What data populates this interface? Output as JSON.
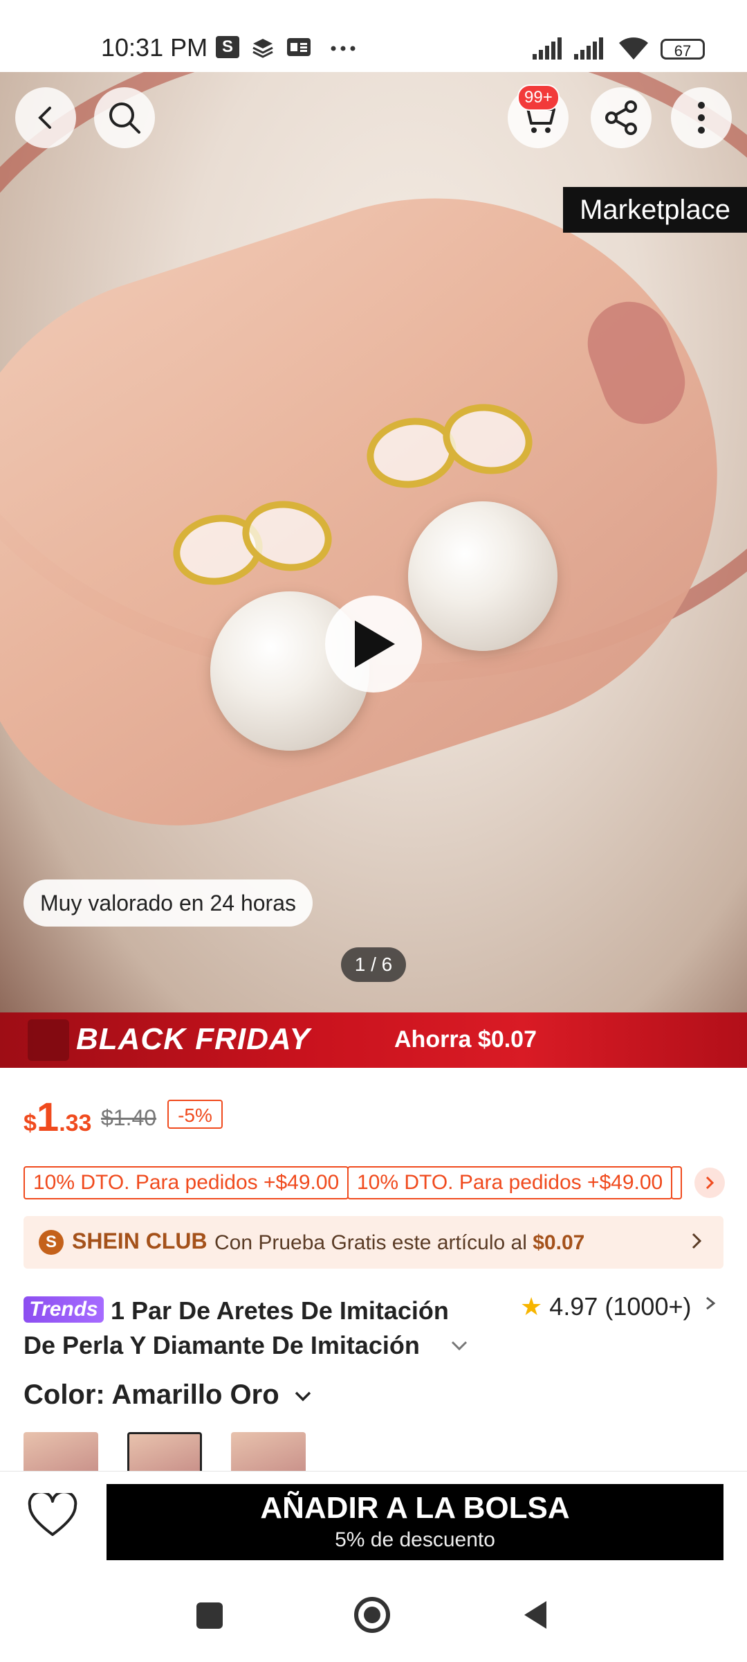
{
  "status_bar": {
    "time": "10:31 PM",
    "icons": [
      "s-app-icon",
      "layers-icon",
      "ge-icon",
      "more-dots-icon"
    ],
    "battery": "67"
  },
  "header": {
    "cart_badge": "99+",
    "marketplace_label": "Marketplace"
  },
  "gallery": {
    "rated_label": "Muy valorado en 24 horas",
    "pager": "1 / 6"
  },
  "promo_banner": {
    "label": "BLACK FRIDAY",
    "savings": "Ahorra $0.07"
  },
  "price": {
    "currency": "$",
    "integer": "1",
    "decimal": ".33",
    "original": "$1.40",
    "discount": "-5%"
  },
  "coupons": [
    "10% DTO. Para pedidos +$49.00",
    "10% DTO. Para pedidos +$49.00"
  ],
  "club": {
    "badge": "S",
    "name": "SHEIN CLUB",
    "description": "Con Prueba Gratis este artículo al ",
    "price": "$0.07"
  },
  "product": {
    "tag": "Trends",
    "title": "1 Par De Aretes De Imitación De Perla Y Diamante De Imitación",
    "rating": "4.97",
    "reviews": "(1000+)"
  },
  "variant": {
    "color_label": "Color: Amarillo Oro"
  },
  "action_bar": {
    "add_label": "AÑADIR A LA BOLSA",
    "add_sub": "5% de descuento"
  },
  "colors": {
    "accent": "#f04a1d",
    "banner_red": "#c8121d",
    "button": "#000000",
    "club_bg": "#fdeee6",
    "star": "#f7b500"
  }
}
